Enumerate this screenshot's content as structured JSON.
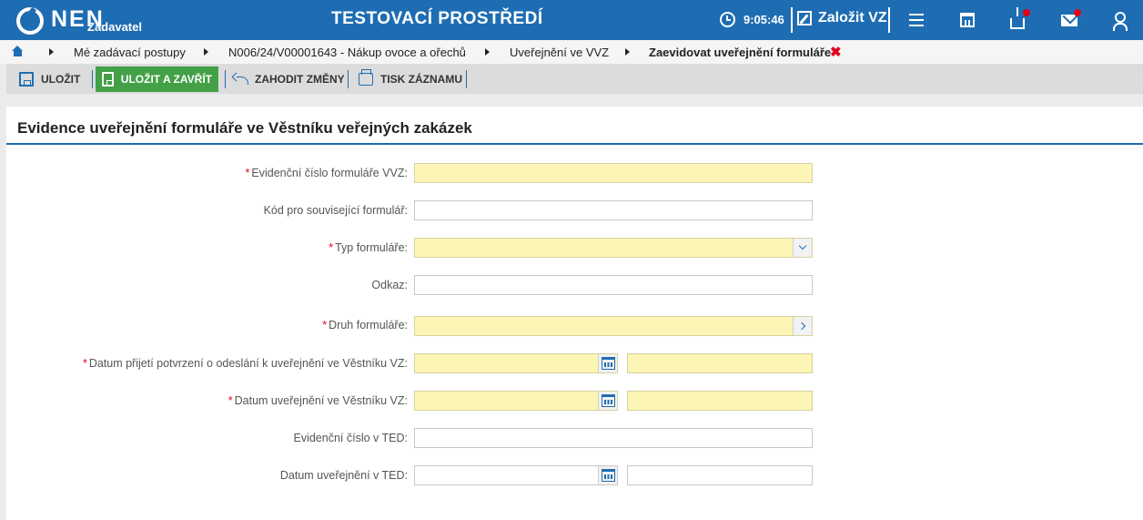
{
  "header": {
    "logo_text": "NEN",
    "logo_sub": "Zadavatel",
    "environment_title": "TESTOVACÍ PROSTŘEDÍ",
    "clock_time": "9:05:46",
    "create_vz_label": "Založit VZ",
    "icons": [
      "clock-icon",
      "edit-icon",
      "menu-icon",
      "calendar-icon",
      "inbox-icon",
      "mail-icon",
      "user-icon"
    ],
    "accent_color": "#1e6db3",
    "badge_color": "#e3001b"
  },
  "breadcrumb": {
    "items": [
      "Mé zadávací postupy",
      "N006/24/V00001643 - Nákup ovoce a ořechů",
      "Uveřejnění ve VVZ",
      "Zaevidovat uveřejnění formuláře"
    ],
    "close_symbol": "✖"
  },
  "toolbar": {
    "save_label": "ULOŽIT",
    "save_close_label": "ULOŽIT A ZAVŘÍT",
    "discard_label": "ZAHODIT ZMĚNY",
    "print_label": "TISK ZÁZNAMU",
    "primary_color": "#43a047"
  },
  "form": {
    "title": "Evidence uveřejnění formuláře ve Věstníku veřejných zakázek",
    "required_mark": "*",
    "fields": [
      {
        "label": "Evidenční číslo formuláře VVZ:",
        "required": true,
        "value": ""
      },
      {
        "label": "Kód pro související formulář:",
        "required": false,
        "value": ""
      },
      {
        "label": "Typ formuláře:",
        "required": true,
        "value": ""
      },
      {
        "label": "Odkaz:",
        "required": false,
        "value": ""
      },
      {
        "label": "Druh formuláře:",
        "required": true,
        "value": ""
      },
      {
        "label": "Datum přijetí potvrzení o odeslání k uveřejnění ve Věstníku VZ:",
        "required": true,
        "date": "",
        "time": ""
      },
      {
        "label": "Datum uveřejnění ve Věstníku VZ:",
        "required": true,
        "date": "",
        "time": ""
      },
      {
        "label": "Evidenční číslo v TED:",
        "required": false,
        "value": ""
      },
      {
        "label": "Datum uveřejnění v TED:",
        "required": false,
        "date": "",
        "time": ""
      }
    ],
    "required_field_color": "#fdf5b5"
  }
}
